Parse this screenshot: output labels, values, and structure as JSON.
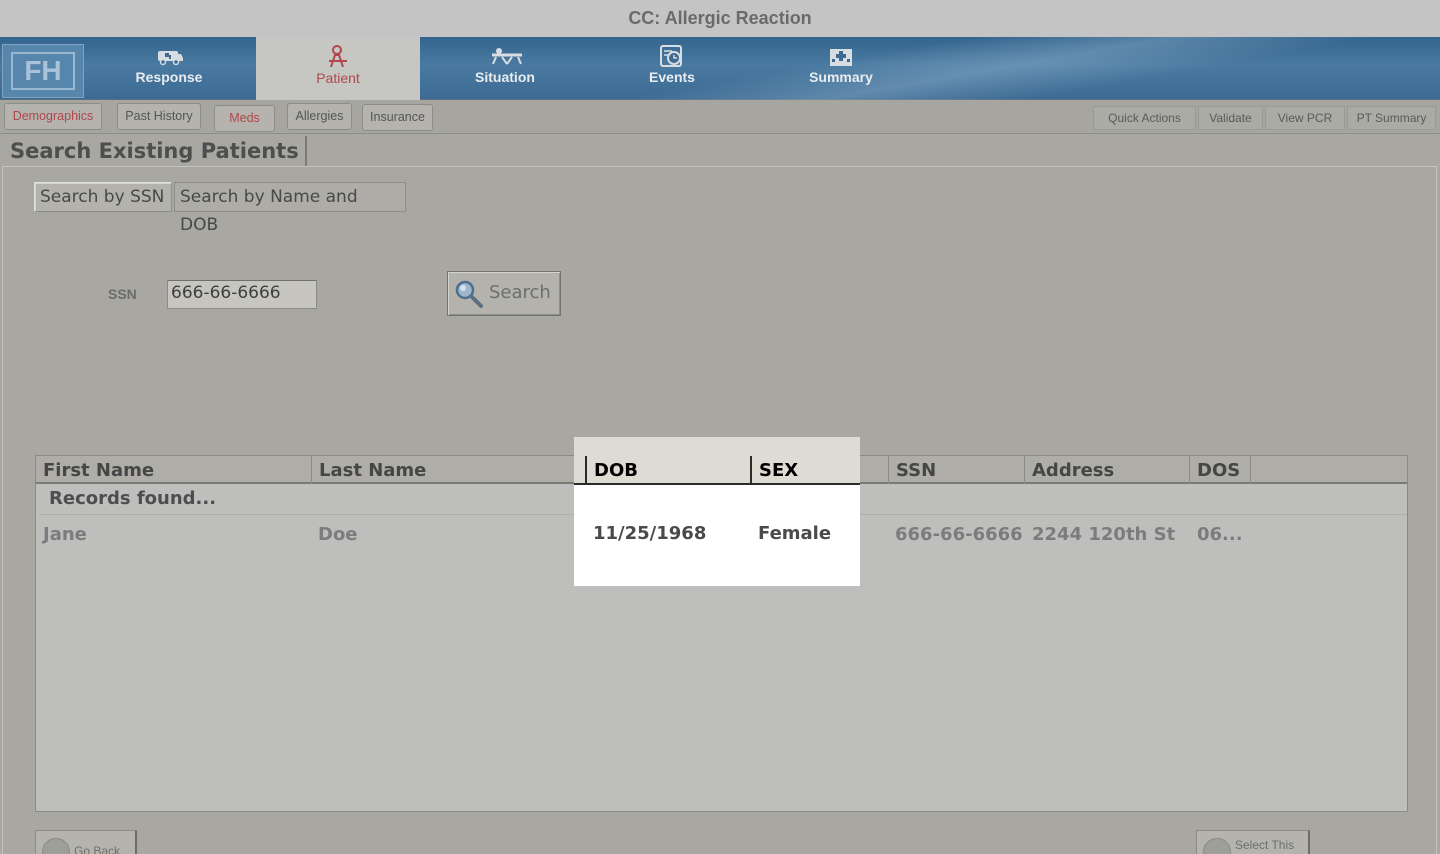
{
  "window": {
    "title": "CC: Allergic Reaction"
  },
  "logo": {
    "text": "FH"
  },
  "nav": {
    "tabs": [
      {
        "label": "Response",
        "icon": "ambulance-icon"
      },
      {
        "label": "Patient",
        "icon": "patient-icon",
        "active": true
      },
      {
        "label": "Situation",
        "icon": "stretcher-icon"
      },
      {
        "label": "Events",
        "icon": "clock-icon"
      },
      {
        "label": "Summary",
        "icon": "hospital-icon"
      }
    ]
  },
  "subtabs": [
    "Demographics",
    "Past History",
    "Meds",
    "Allergies",
    "Insurance"
  ],
  "quick_actions": [
    "Quick Actions",
    "Validate",
    "View PCR",
    "PT Summary"
  ],
  "section": {
    "title": "Search Existing Patients"
  },
  "search_tabs": [
    "Search by SSN",
    "Search by Name and DOB"
  ],
  "ssn": {
    "label": "SSN",
    "value": "666-66-6666"
  },
  "search_button": {
    "label": "Search"
  },
  "grid": {
    "columns": [
      "First Name",
      "Last Name",
      "DOB",
      "SEX",
      "SSN",
      "Address",
      "DOS"
    ],
    "status": "Records found...",
    "rows": [
      {
        "first": "Jane",
        "last": "Doe",
        "dob": "11/25/1968",
        "sex": "Female",
        "ssn": "666-66-6666",
        "address": "2244 120th St",
        "dos": "06..."
      }
    ]
  },
  "footer": {
    "back_label": "Go Back",
    "select_label": "Select This"
  },
  "colors": {
    "nav_blue": "#3c6a93",
    "accent_red": "#b0474c",
    "overlay": "#a8a7a1"
  }
}
